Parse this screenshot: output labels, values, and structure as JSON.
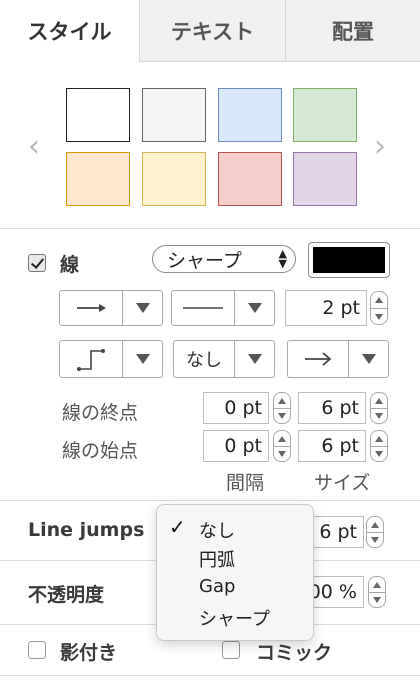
{
  "tabs": [
    {
      "label": "スタイル",
      "active": true
    },
    {
      "label": "テキスト",
      "active": false
    },
    {
      "label": "配置",
      "active": false
    }
  ],
  "swatches": [
    {
      "fill": "#ffffff",
      "stroke": "#1f1f1f"
    },
    {
      "fill": "#f5f5f5",
      "stroke": "#666666"
    },
    {
      "fill": "#dae8fc",
      "stroke": "#6c8ebf"
    },
    {
      "fill": "#d5e8d4",
      "stroke": "#82b366"
    },
    {
      "fill": "#ffe6cc",
      "stroke": "#d79b00"
    },
    {
      "fill": "#fff2cc",
      "stroke": "#d6b656"
    },
    {
      "fill": "#f8cecc",
      "stroke": "#b85450"
    },
    {
      "fill": "#e1d5e7",
      "stroke": "#9673a6"
    }
  ],
  "line": {
    "label": "線",
    "checked": true,
    "style_select": "シャープ",
    "color": "#000000",
    "width_value": "2 pt",
    "waypoint_value": "なし",
    "end_label": "線の終点",
    "start_label": "線の始点",
    "end_spacing": "0 pt",
    "end_size": "6 pt",
    "start_spacing": "0 pt",
    "start_size": "6 pt",
    "spacing_header": "間隔",
    "size_header": "サイズ"
  },
  "line_jumps": {
    "label": "Line jumps",
    "size_value": "6 pt"
  },
  "opacity": {
    "label": "不透明度",
    "value": "00 %"
  },
  "shadow": {
    "label": "影付き",
    "checked": false
  },
  "comic": {
    "label": "コミック",
    "checked": false
  },
  "dropdown": {
    "items": [
      {
        "label": "なし",
        "selected": true
      },
      {
        "label": "円弧",
        "selected": false
      },
      {
        "label": "Gap",
        "selected": false
      },
      {
        "label": "シャープ",
        "selected": false
      }
    ]
  },
  "icons": {
    "nav_left": "chevron-left-icon",
    "nav_right": "chevron-right-icon",
    "check": "checkmark-icon"
  }
}
